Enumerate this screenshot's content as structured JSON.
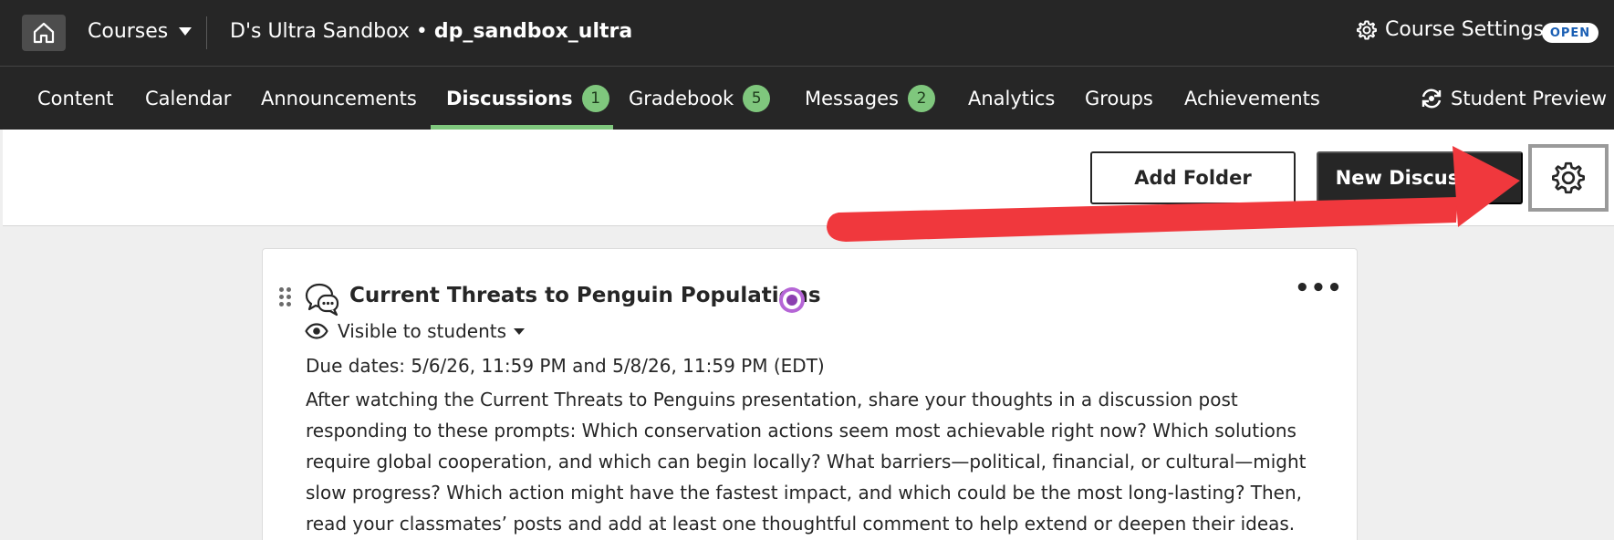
{
  "topbar": {
    "courses_label": "Courses",
    "course_name": "D's Ultra Sandbox •",
    "course_code": "dp_sandbox_ultra",
    "settings_label": "Course Settings",
    "open_badge": "OPEN",
    "icons": [
      "home-icon",
      "chevron-down-icon",
      "gear-icon"
    ]
  },
  "nav": {
    "items": [
      {
        "label": "Content"
      },
      {
        "label": "Calendar"
      },
      {
        "label": "Announcements"
      },
      {
        "label": "Discussions",
        "count": "1",
        "active": true
      },
      {
        "label": "Gradebook",
        "count": "5"
      },
      {
        "label": "Messages",
        "count": "2"
      },
      {
        "label": "Analytics"
      },
      {
        "label": "Groups"
      },
      {
        "label": "Achievements"
      }
    ],
    "preview_label": "Student Preview",
    "accent_color": "#7fc77d"
  },
  "toolbar": {
    "add_folder_label": "Add Folder",
    "new_discussion_label": "New Discussion",
    "settings_icon": "gear-icon"
  },
  "annotation": {
    "arrow_color": "#f0383d",
    "points_to": "discussion-settings-gear"
  },
  "discussion": {
    "title": "Current Threats to Penguin Populations",
    "visibility": "Visible to students",
    "due_dates": "Due dates: 5/6/26, 11:59 PM and 5/8/26, 11:59 PM (EDT)",
    "description_lines": [
      "After watching the Current Threats to Penguins presentation, share your thoughts in a discussion post",
      "responding to these prompts: Which conservation actions seem most achievable right now? Which solutions",
      "require global cooperation, and which can begin locally? What barriers—political, financial, or cultural—might",
      "slow progress? Which action might have the fastest impact, and which could be the most long-lasting? Then,",
      "read your classmates’ posts and add at least one thoughtful comment to help extend or deepen their ideas."
    ],
    "more_label": "•••",
    "status_color": "#b565d6"
  }
}
